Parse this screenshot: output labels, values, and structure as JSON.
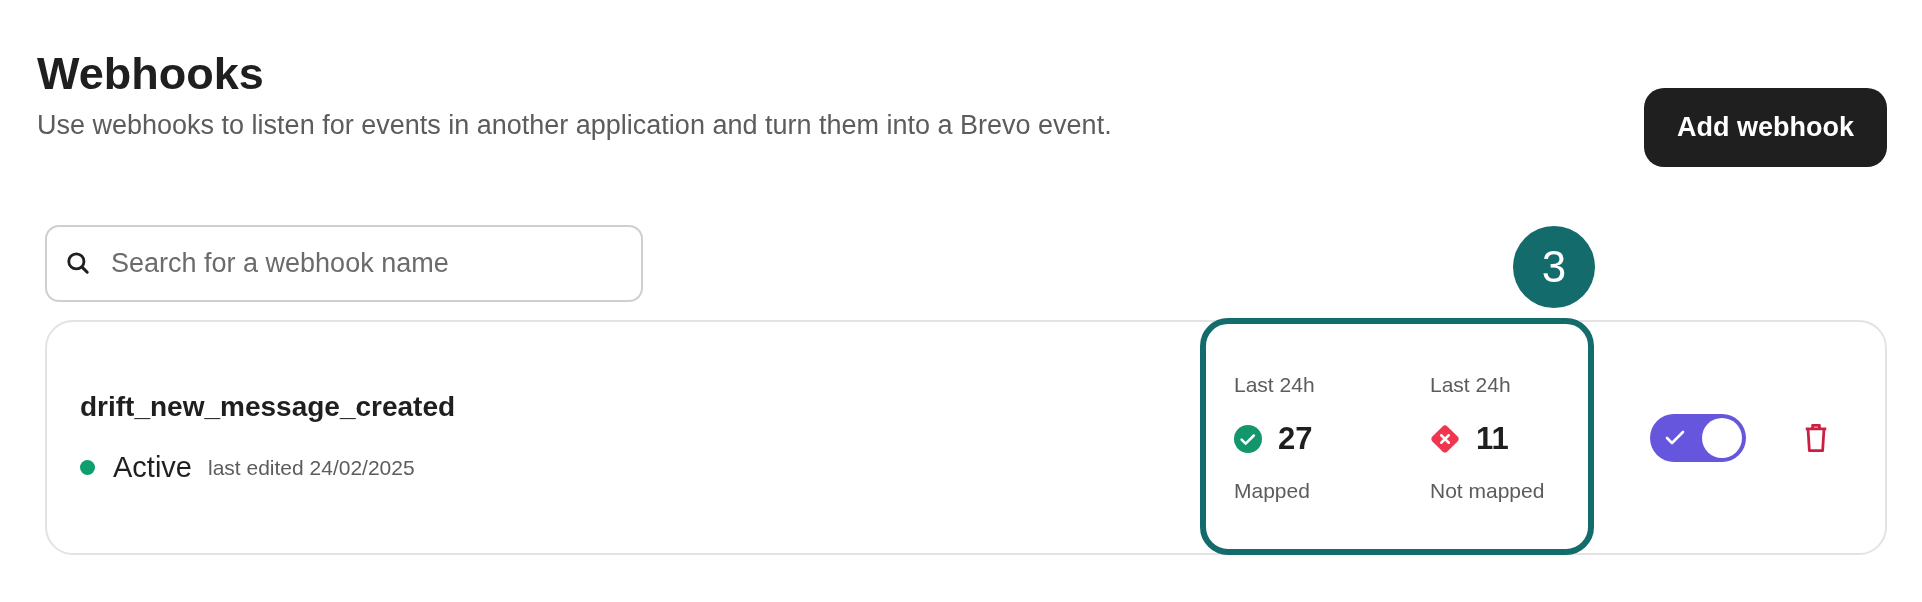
{
  "header": {
    "title": "Webhooks",
    "subtitle": "Use webhooks to listen for events in another application and turn them into a Brevo event.",
    "button": "Add webhook"
  },
  "search": {
    "placeholder": "Search for a webhook name"
  },
  "webhooks": [
    {
      "name": "drift_new_message_created",
      "status": "Active",
      "color": "#0f9f6e",
      "edited": "last edited 24/02/2025",
      "enabled": true,
      "stats": [
        {
          "kind": "mapped",
          "period": "Last 24h",
          "count": "27",
          "label": "Mapped"
        },
        {
          "kind": "not_mapped",
          "period": "Last 24h",
          "count": "11",
          "label": "Not mapped"
        }
      ],
      "annotation": {
        "number": "3"
      }
    }
  ]
}
